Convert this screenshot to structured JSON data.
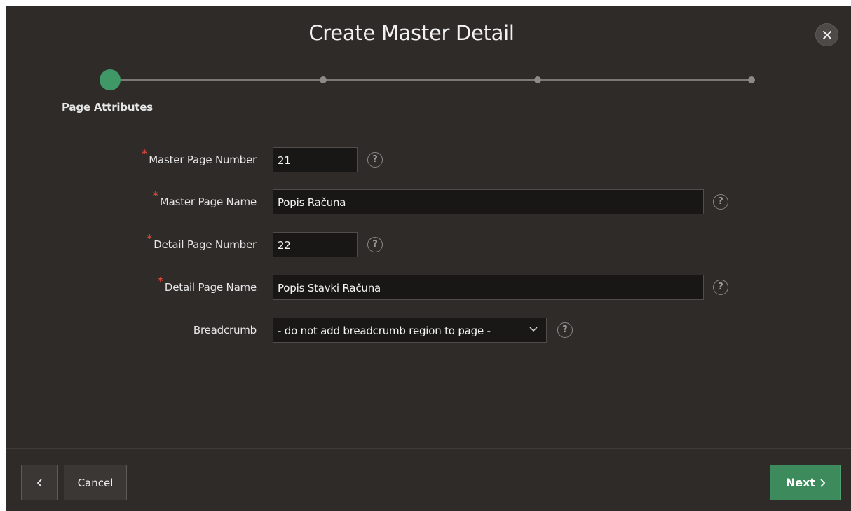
{
  "dialog": {
    "title": "Create Master Detail"
  },
  "wizard": {
    "steps": [
      {
        "label": "Page Attributes",
        "active": true
      },
      {
        "label": "",
        "active": false
      },
      {
        "label": "",
        "active": false
      },
      {
        "label": "",
        "active": false
      }
    ],
    "current_step_label": "Page Attributes"
  },
  "form": {
    "master_page_number": {
      "label": "Master Page Number",
      "value": "21",
      "required": true
    },
    "master_page_name": {
      "label": "Master Page Name",
      "value": "Popis Računa",
      "required": true
    },
    "detail_page_number": {
      "label": "Detail Page Number",
      "value": "22",
      "required": true
    },
    "detail_page_name": {
      "label": "Detail Page Name",
      "value": "Popis Stavki Računa",
      "required": true
    },
    "breadcrumb": {
      "label": "Breadcrumb",
      "value": "- do not add breadcrumb region to page -",
      "required": false
    },
    "help_glyph": "?"
  },
  "footer": {
    "cancel_label": "Cancel",
    "next_label": "Next"
  },
  "colors": {
    "background": "#2e2b29",
    "accent": "#3f9866",
    "required": "#d9483b",
    "input_bg": "#191716"
  },
  "icons": {
    "close": "close-icon",
    "back": "chevron-left-icon",
    "next": "chevron-right-icon",
    "help": "help-icon",
    "select": "chevron-down-icon"
  }
}
